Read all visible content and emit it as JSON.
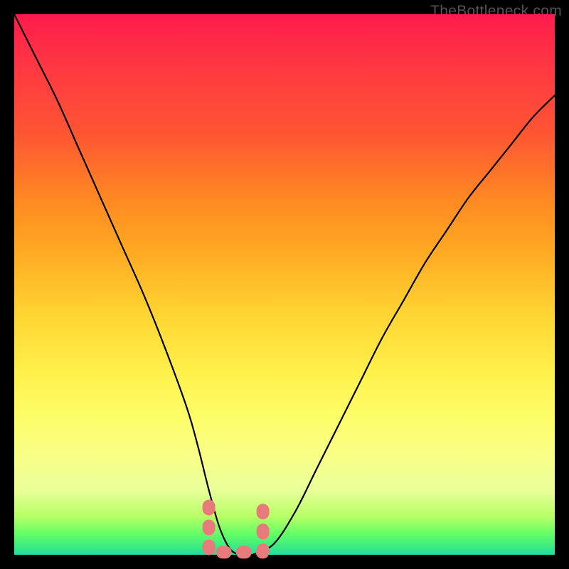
{
  "watermark": "TheBottleneck.com",
  "chart_data": {
    "type": "line",
    "title": "",
    "xlabel": "",
    "ylabel": "",
    "xlim": [
      0,
      100
    ],
    "ylim": [
      0,
      100
    ],
    "series": [
      {
        "name": "bottleneck-curve",
        "x": [
          0,
          4,
          8,
          12,
          16,
          20,
          24,
          28,
          32,
          34,
          36,
          38,
          40,
          42,
          44,
          48,
          52,
          56,
          60,
          64,
          68,
          72,
          76,
          80,
          84,
          88,
          92,
          96,
          100
        ],
        "values": [
          100,
          92,
          84,
          75,
          66,
          57,
          48,
          38,
          27,
          20,
          12,
          5,
          1,
          0,
          0,
          2,
          8,
          16,
          24,
          32,
          40,
          47,
          54,
          60,
          66,
          71,
          76,
          81,
          85
        ]
      }
    ],
    "annotations": [
      {
        "name": "minimum-bracket",
        "shape": "L-bracket",
        "x_range": [
          36,
          46
        ],
        "y_level": 1,
        "color": "#e77a7a"
      }
    ]
  }
}
